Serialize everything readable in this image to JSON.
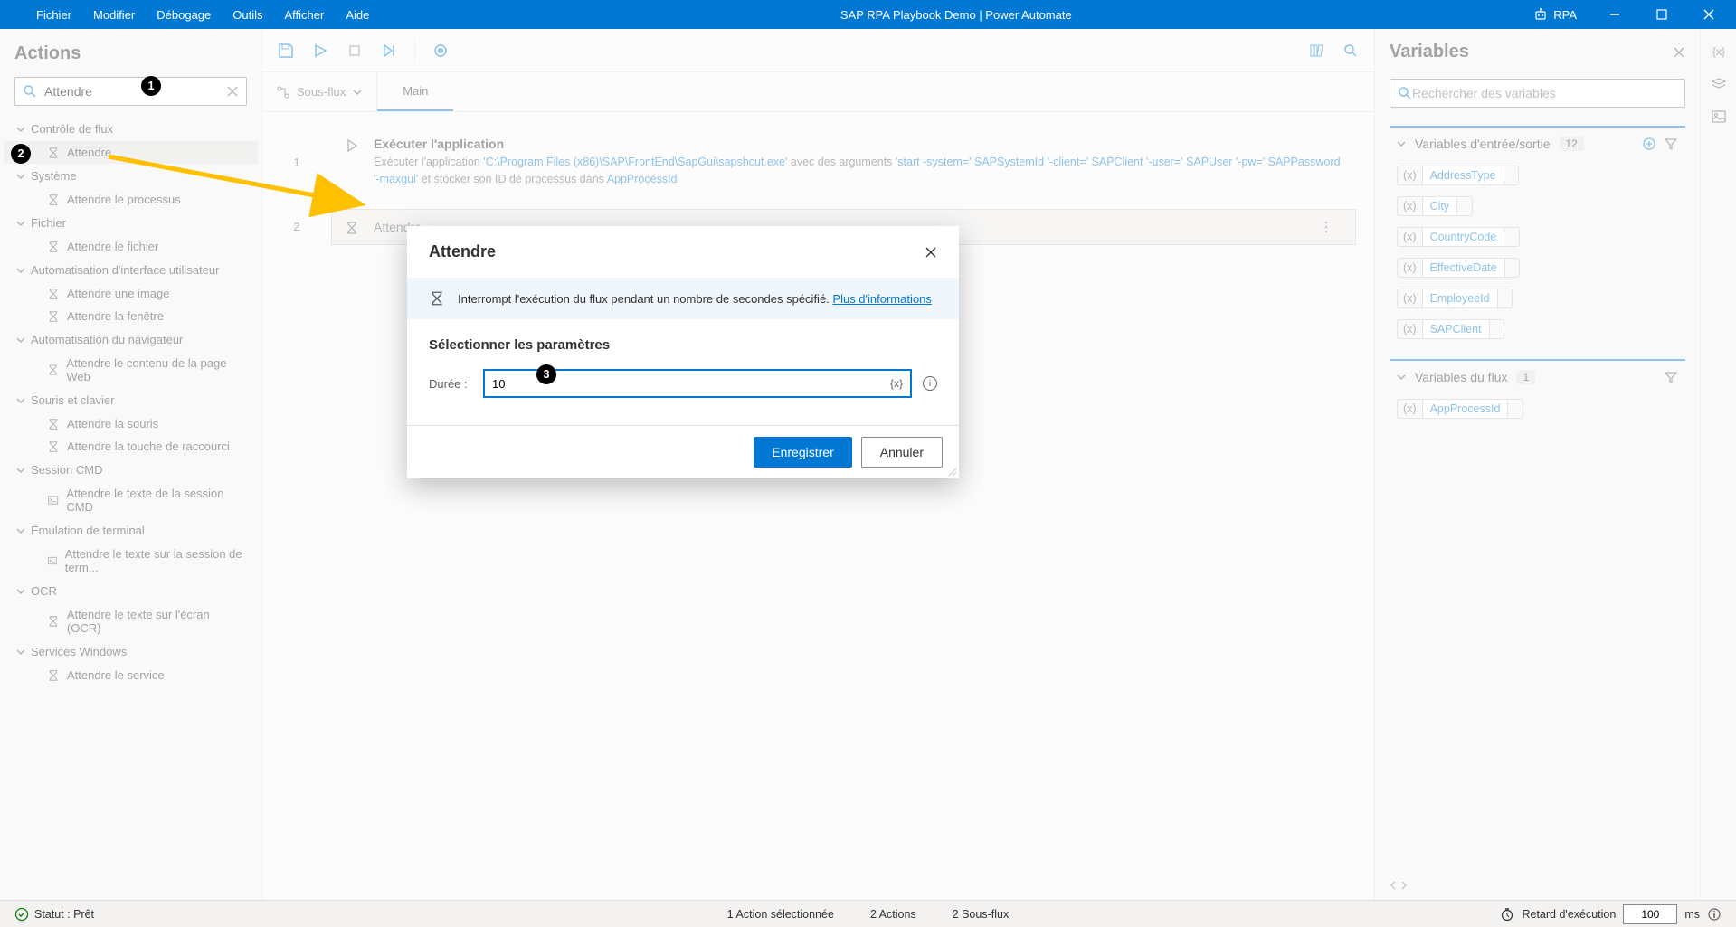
{
  "titlebar": {
    "menu": [
      "Fichier",
      "Modifier",
      "Débogage",
      "Outils",
      "Afficher",
      "Aide"
    ],
    "title": "SAP RPA Playbook Demo | Power Automate",
    "rpa_label": "RPA"
  },
  "actions": {
    "header": "Actions",
    "search_value": "Attendre",
    "groups": [
      {
        "label": "Contrôle de flux",
        "items": [
          "Attendre"
        ]
      },
      {
        "label": "Système",
        "items": [
          "Attendre le processus"
        ]
      },
      {
        "label": "Fichier",
        "items": [
          "Attendre le fichier"
        ]
      },
      {
        "label": "Automatisation d'interface utilisateur",
        "items": [
          "Attendre une image",
          "Attendre la fenêtre"
        ]
      },
      {
        "label": "Automatisation du navigateur",
        "items": [
          "Attendre le contenu de la page Web"
        ]
      },
      {
        "label": "Souris et clavier",
        "items": [
          "Attendre la souris",
          "Attendre la touche de raccourci"
        ]
      },
      {
        "label": "Session CMD",
        "items": [
          "Attendre le texte de la session CMD"
        ],
        "icon": "cmd"
      },
      {
        "label": "Émulation de terminal",
        "items": [
          "Attendre le texte sur la session de term..."
        ],
        "icon": "cmd"
      },
      {
        "label": "OCR",
        "items": [
          "Attendre le texte sur l'écran (OCR)"
        ]
      },
      {
        "label": "Services Windows",
        "items": [
          "Attendre le service"
        ]
      }
    ]
  },
  "designer": {
    "subflow_label": "Sous-flux",
    "tab_main": "Main",
    "steps": {
      "s1": {
        "title": "Exécuter l'application",
        "desc_pre": "Exécuter l'application ",
        "tok1": "'C:\\Program Files (x86)\\SAP\\FrontEnd\\SapGui\\sapshcut.exe'",
        "mid1": " avec des arguments ",
        "tok2": "'start -system='",
        "tok3": "SAPSystemId",
        "tok4": "'-client='",
        "tok5": "SAPClient",
        "tok6": "'-user='",
        "tok7": "SAPUser",
        "tok8": "'-pw='",
        "tok9": "SAPPassword",
        "tok10": "'-maxgui'",
        "mid2": " et stocker son ID de processus dans ",
        "tok11": "AppProcessId"
      },
      "s2": {
        "title": "Attendre"
      }
    }
  },
  "variables": {
    "header": "Variables",
    "search_placeholder": "Rechercher des variables",
    "io_section": "Variables d'entrée/sortie",
    "io_count": "12",
    "io_vars": [
      "AddressType",
      "City",
      "CountryCode",
      "EffectiveDate",
      "EmployeeId",
      "SAPClient"
    ],
    "flux_section": "Variables du flux",
    "flux_count": "1",
    "flux_vars": [
      "AppProcessId"
    ]
  },
  "modal": {
    "title": "Attendre",
    "info_text": "Interrompt l'exécution du flux pendant un nombre de secondes spécifié. ",
    "info_link": "Plus d'informations",
    "params_header": "Sélectionner les paramètres",
    "duration_label": "Durée :",
    "duration_value": "10",
    "save": "Enregistrer",
    "cancel": "Annuler"
  },
  "statusbar": {
    "status": "Statut : Prêt",
    "sel_actions": "1 Action sélectionnée",
    "actions_count": "2 Actions",
    "subflows": "2 Sous-flux",
    "delay_label": "Retard d'exécution",
    "delay_value": "100",
    "delay_unit": "ms"
  },
  "callouts": {
    "c1": "1",
    "c2": "2",
    "c3": "3"
  }
}
